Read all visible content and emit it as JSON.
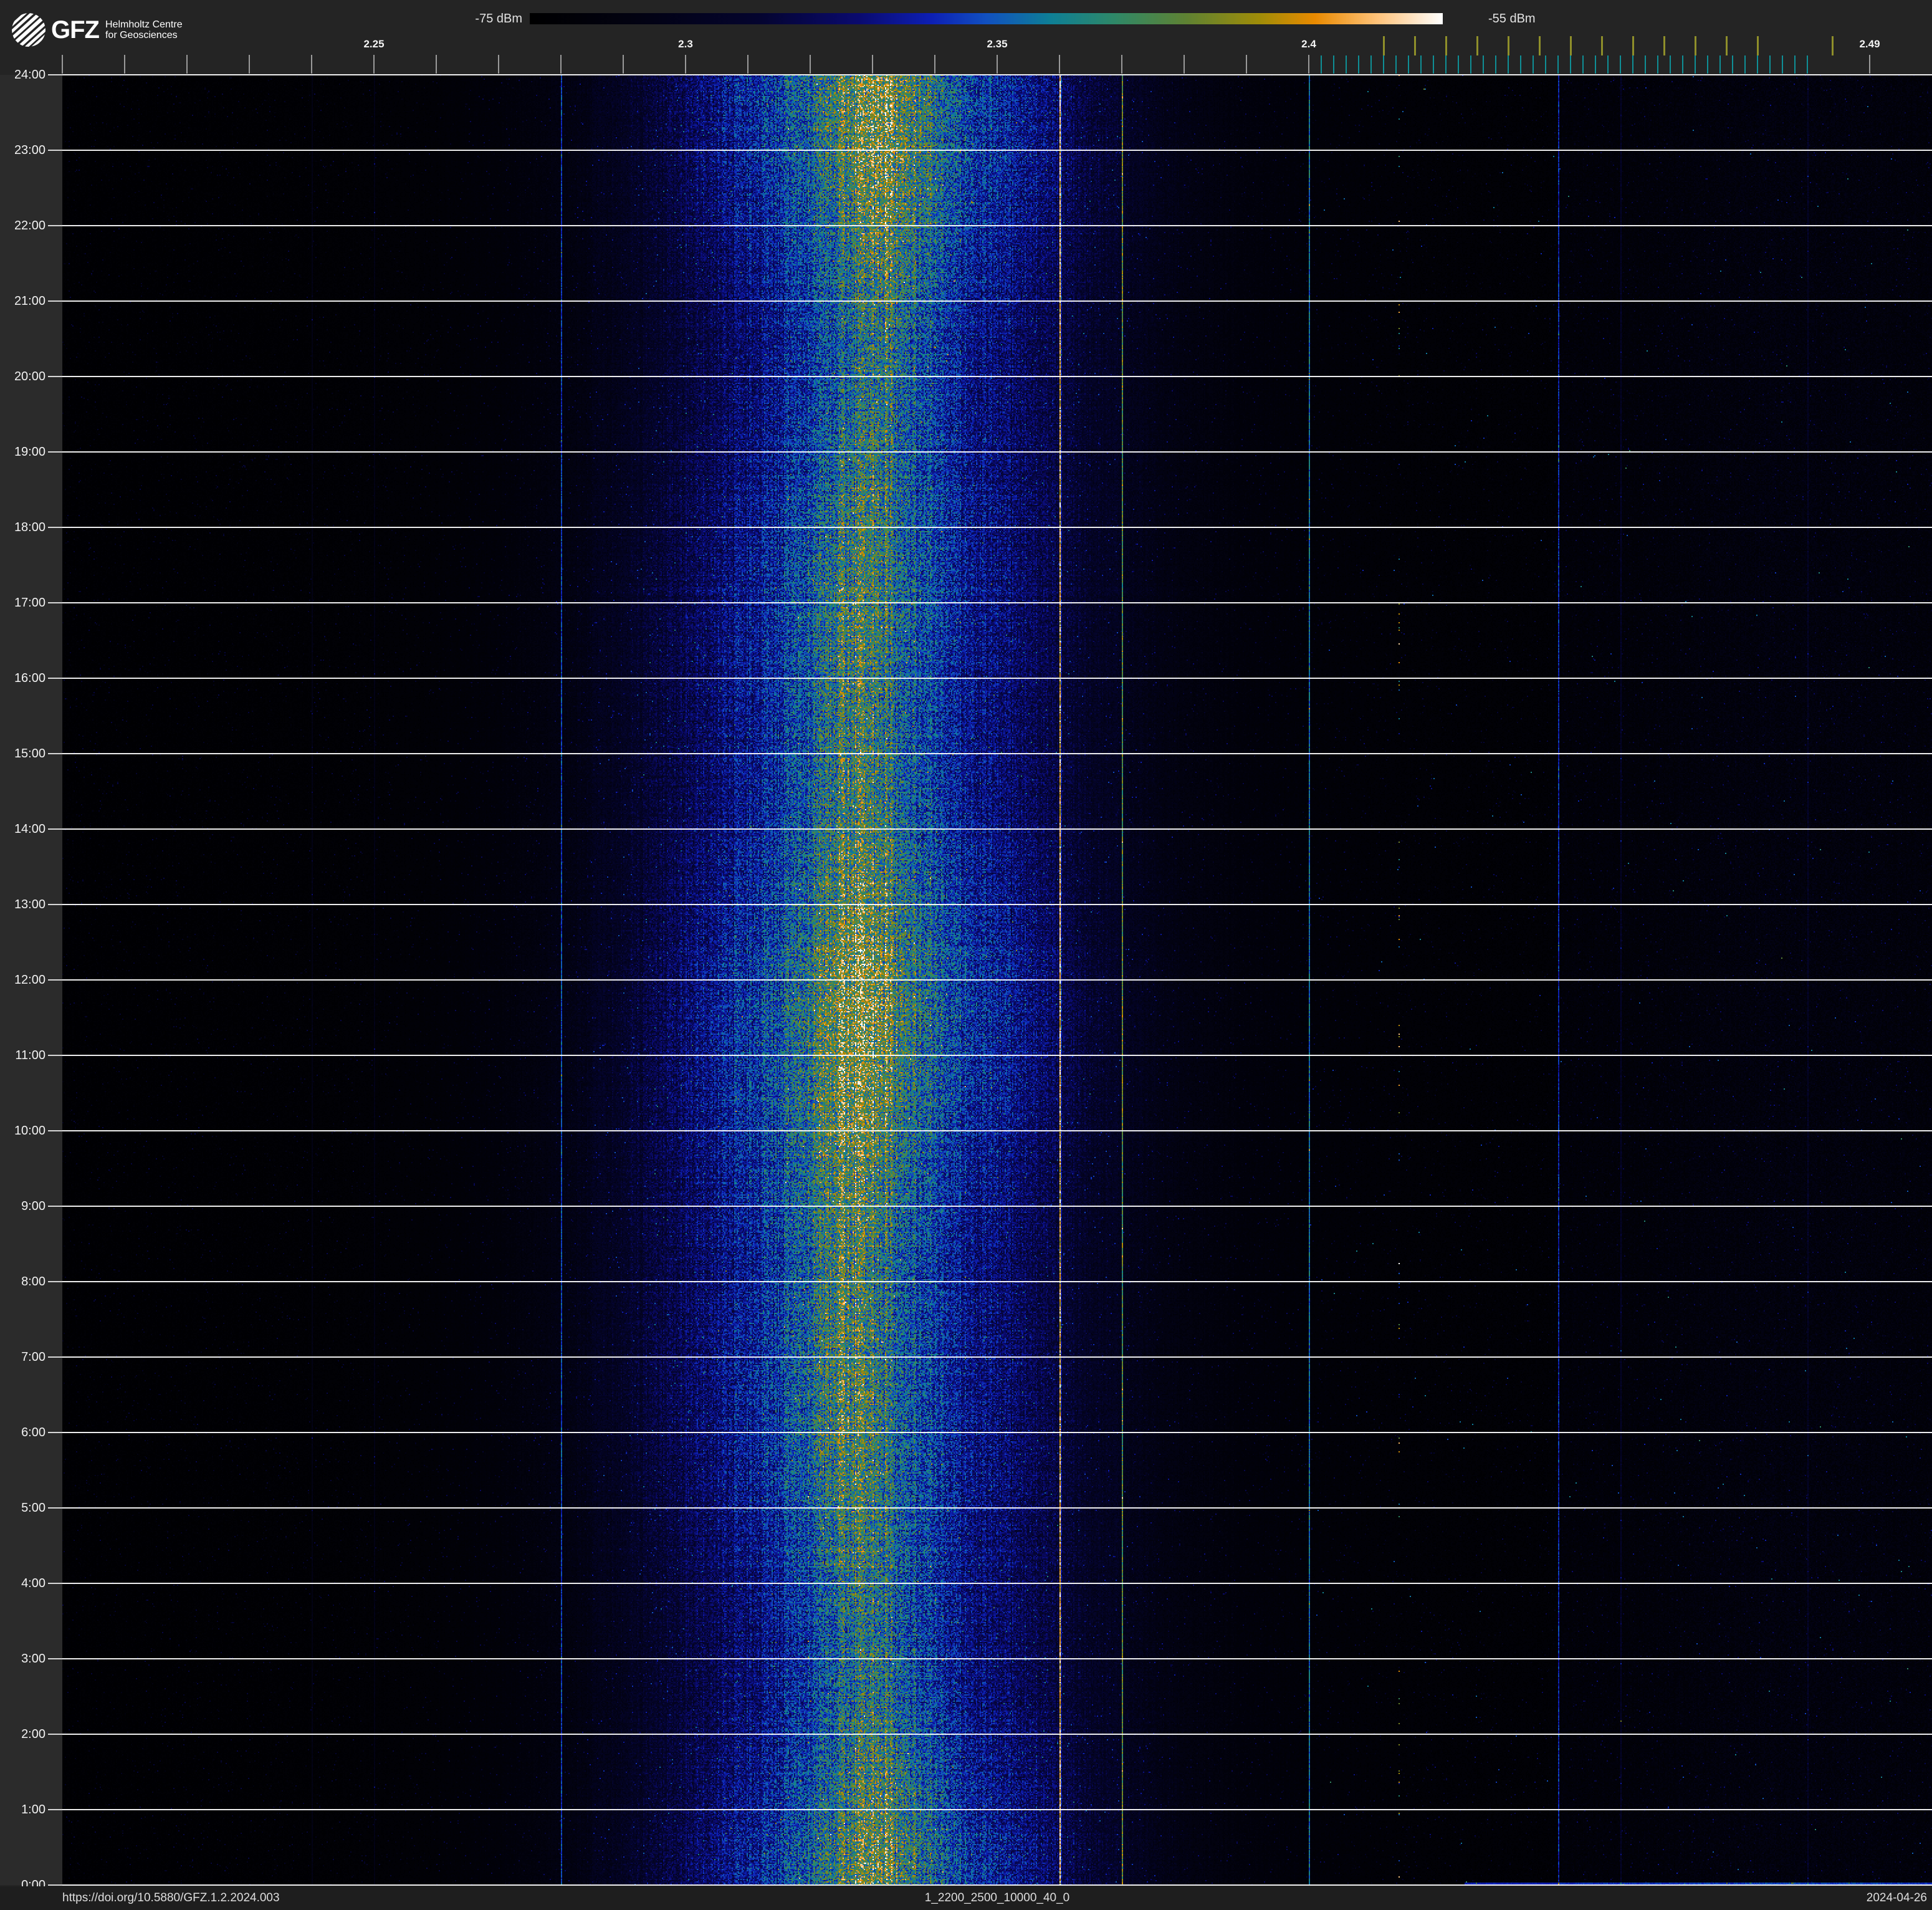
{
  "branding": {
    "logo_text": "GFZ",
    "affiliation_line1": "Helmholtz Centre",
    "affiliation_line2": "for Geosciences"
  },
  "colorbar": {
    "min_label": "-75 dBm",
    "max_label": "-55 dBm"
  },
  "footer": {
    "doi": "https://doi.org/10.5880/GFZ.1.2.2024.003",
    "dataset_id": "1_2200_2500_10000_40_0",
    "date": "2024-04-26"
  },
  "theme": {
    "page_bg": "#242424",
    "gutter_bg": "#2b2b2b",
    "footer_bg": "#1e1e1e",
    "grid_color": "#ffffff",
    "tick_color": "#9a9a9a",
    "wifi_tick_color": "#8f8f2a",
    "ble_tick_color": "#0f8f96",
    "label_color": "#f5f5f5"
  },
  "chart_data": {
    "type": "heatmap",
    "subtype": "rf-spectrogram-waterfall",
    "title": "",
    "x_axis": {
      "unit": "GHz",
      "range_ghz": [
        2.2,
        2.5
      ],
      "major_ticks": [
        {
          "value": 2.25,
          "label": "2.25"
        },
        {
          "value": 2.3,
          "label": "2.3"
        },
        {
          "value": 2.35,
          "label": "2.35"
        },
        {
          "value": 2.4,
          "label": "2.4"
        },
        {
          "value": 2.49,
          "label": "2.49"
        }
      ],
      "minor_ticks_ghz": [
        2.2,
        2.21,
        2.22,
        2.23,
        2.24,
        2.25,
        2.26,
        2.27,
        2.28,
        2.29,
        2.3,
        2.31,
        2.32,
        2.33,
        2.34,
        2.35,
        2.36,
        2.37,
        2.38,
        2.39,
        2.4,
        2.49
      ],
      "wifi_channel_ticks_ghz": [
        2.412,
        2.417,
        2.422,
        2.427,
        2.432,
        2.437,
        2.442,
        2.447,
        2.452,
        2.457,
        2.462,
        2.467,
        2.472,
        2.484
      ],
      "ble_channel_ticks_ghz": [
        2.402,
        2.404,
        2.406,
        2.408,
        2.41,
        2.412,
        2.414,
        2.416,
        2.418,
        2.42,
        2.422,
        2.424,
        2.426,
        2.428,
        2.43,
        2.432,
        2.434,
        2.436,
        2.438,
        2.44,
        2.442,
        2.444,
        2.446,
        2.448,
        2.45,
        2.452,
        2.454,
        2.456,
        2.458,
        2.46,
        2.462,
        2.464,
        2.466,
        2.468,
        2.47,
        2.472,
        2.474,
        2.476,
        2.478,
        2.48
      ]
    },
    "y_axis": {
      "unit": "time of day",
      "hours_span": 24,
      "hour_labels": [
        "24:00",
        "23:00",
        "22:00",
        "21:00",
        "20:00",
        "19:00",
        "18:00",
        "17:00",
        "16:00",
        "15:00",
        "14:00",
        "13:00",
        "12:00",
        "11:00",
        "10:00",
        "9:00",
        "8:00",
        "7:00",
        "6:00",
        "5:00",
        "4:00",
        "3:00",
        "2:00",
        "1:00",
        "0:00"
      ]
    },
    "colorbar": {
      "min_dbm": -75,
      "max_dbm": -55,
      "stops": [
        [
          0.0,
          "#000000"
        ],
        [
          0.12,
          "#020212"
        ],
        [
          0.25,
          "#04042e"
        ],
        [
          0.36,
          "#0a0a6e"
        ],
        [
          0.44,
          "#0d1fb4"
        ],
        [
          0.5,
          "#1150c0"
        ],
        [
          0.57,
          "#0e7f96"
        ],
        [
          0.64,
          "#2e8868"
        ],
        [
          0.72,
          "#5f8232"
        ],
        [
          0.8,
          "#a08c08"
        ],
        [
          0.86,
          "#e98a00"
        ],
        [
          0.93,
          "#ffc47d"
        ],
        [
          1.0,
          "#ffffff"
        ]
      ]
    },
    "features": {
      "wideband_emission": {
        "center_ghz": 2.329,
        "core_span_ghz": [
          2.318,
          2.34
        ],
        "visible_span_ghz": [
          2.295,
          2.385
        ],
        "peak_level": 0.66,
        "center_drift_ghz": 0.002
      },
      "persistent_carriers": [
        {
          "freq_ghz": 2.24,
          "level": 0.1
        },
        {
          "freq_ghz": 2.25,
          "level": 0.1
        },
        {
          "freq_ghz": 2.28,
          "level": 0.38
        },
        {
          "freq_ghz": 2.3,
          "level": 0.08
        },
        {
          "freq_ghz": 2.36,
          "level": 0.6
        },
        {
          "freq_ghz": 2.37,
          "level": 0.52
        },
        {
          "freq_ghz": 2.4,
          "level": 0.5
        },
        {
          "freq_ghz": 2.44,
          "level": 0.38
        },
        {
          "freq_ghz": 2.45,
          "level": 0.16
        },
        {
          "freq_ghz": 2.48,
          "level": 0.12
        }
      ],
      "intermittent_beacon_ghz": 2.4145,
      "ism_noise_span_ghz": [
        2.44,
        2.5
      ]
    }
  }
}
